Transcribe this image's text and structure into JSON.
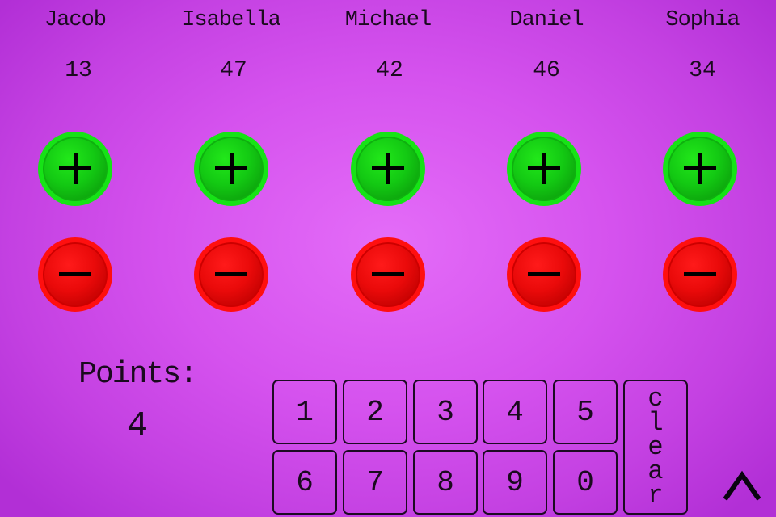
{
  "players": [
    {
      "name": "Jacob",
      "score": "13"
    },
    {
      "name": "Isabella",
      "score": "47"
    },
    {
      "name": "Michael",
      "score": "42"
    },
    {
      "name": "Daniel",
      "score": "46"
    },
    {
      "name": "Sophia",
      "score": "34"
    }
  ],
  "points": {
    "label": "Points:",
    "value": "4"
  },
  "keypad": {
    "keys": [
      "1",
      "2",
      "3",
      "4",
      "5",
      "6",
      "7",
      "8",
      "9",
      "0"
    ],
    "clear_letters": [
      "c",
      "l",
      "e",
      "a",
      "r"
    ]
  },
  "icons": {
    "plus": "plus-icon",
    "minus": "minus-icon",
    "caret": "caret-up-icon"
  },
  "colors": {
    "plus_button": "#16e316",
    "minus_button": "#ff0f0f",
    "background_center": "#e46cf8",
    "background_edge": "#b22fd6"
  }
}
